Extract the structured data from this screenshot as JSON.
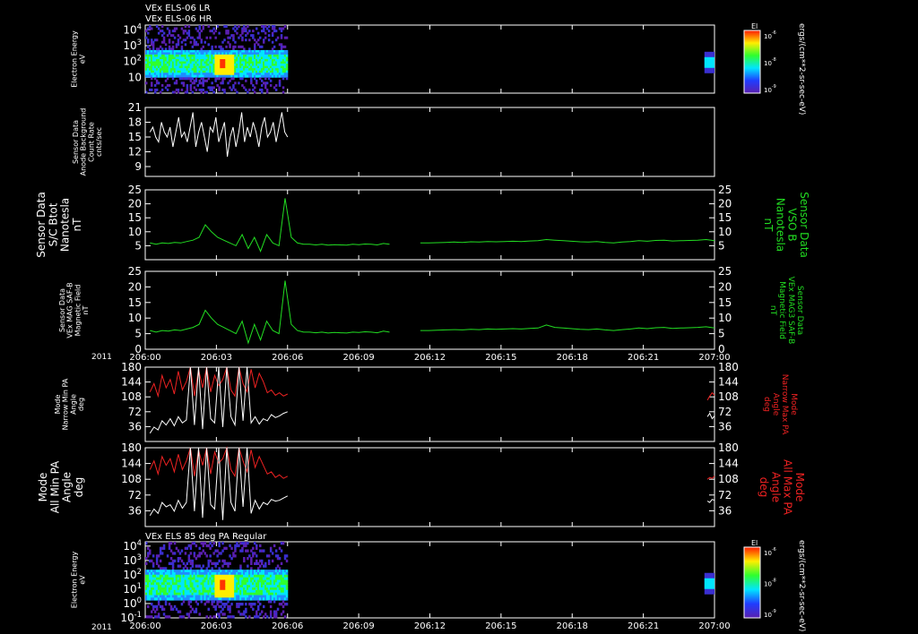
{
  "titles": {
    "top_line1": "VEx ELS-06 LR",
    "top_line2": "VEx ELS-06 HR",
    "bottom": "VEx ELS 85 deg PA Regular"
  },
  "year_label": "2011",
  "x_ticks": [
    "206:00",
    "206:03",
    "206:06",
    "206:09",
    "206:12",
    "206:15",
    "206:18",
    "206:21",
    "207:00"
  ],
  "colors": {
    "background": "#000000",
    "frame": "#ffffff",
    "green": "#22dd22",
    "red": "#ee2222",
    "white": "#ffffff"
  },
  "chart_data": [
    {
      "type": "heatmap",
      "ylabel": [
        "Electron Energy",
        "eV"
      ],
      "ytick_labels": [
        "10",
        "10^2",
        "10^3",
        "10^4"
      ],
      "y_scale": "log",
      "ylim": [
        1,
        20000
      ],
      "xlim": [
        0,
        24
      ],
      "data_interval": [
        0,
        6
      ],
      "late_interval": [
        23.5,
        24
      ],
      "colorbar": {
        "title": "El",
        "tick_labels": [
          "10^-6",
          "10^-8",
          "10^-9"
        ],
        "unit": "ergs/(cm**2-sr-sec-eV)"
      }
    },
    {
      "type": "line",
      "ylabel": [
        "Sensor Data",
        "Anode Background",
        "Count Rate",
        "cnts/sec"
      ],
      "ytick_labels": [
        "9",
        "12",
        "15",
        "18",
        "21"
      ],
      "ylim": [
        7,
        21
      ],
      "xlim": [
        0,
        24
      ],
      "series": [
        {
          "color": "#ffffff",
          "segments": [
            {
              "t0": 0.2,
              "t1": 6.0,
              "values": [
                16,
                17,
                15,
                14,
                18,
                16,
                15,
                17,
                13,
                16,
                19,
                15,
                16,
                14,
                17,
                20,
                13,
                16,
                18,
                15,
                12,
                17,
                16,
                19,
                14,
                16,
                18,
                11,
                15,
                17,
                13,
                16,
                20,
                14,
                17,
                15,
                18,
                16,
                13,
                17,
                19,
                15,
                16,
                18,
                14,
                17,
                20,
                16,
                15
              ]
            }
          ]
        }
      ]
    },
    {
      "type": "line",
      "ylabel": [
        "Sensor Data",
        "S/C Btot",
        "Nanotesla",
        "nT"
      ],
      "right_label": [
        "Sensor Data",
        "VSO B",
        "Nanotesla",
        "nT"
      ],
      "ytick_labels": [
        "5",
        "10",
        "15",
        "20",
        "25"
      ],
      "ylim": [
        0,
        25
      ],
      "xlim": [
        0,
        24
      ],
      "series": [
        {
          "color": "#22dd22",
          "segments": [
            {
              "t0": 0.2,
              "t1": 10.3,
              "values": [
                6,
                5.5,
                6,
                5.8,
                6.2,
                6,
                6.5,
                7,
                8,
                12.5,
                10,
                8,
                7,
                6,
                5,
                9,
                4,
                8,
                3,
                9,
                6,
                5,
                22,
                8,
                6,
                5.5,
                5.5,
                5.3,
                5.5,
                5.2,
                5.4,
                5.3,
                5.2,
                5.5,
                5.4,
                5.6,
                5.5,
                5.3,
                5.8,
                5.5
              ]
            },
            {
              "t0": 11.6,
              "t1": 24.0,
              "values": [
                6,
                6,
                6.1,
                6.2,
                6.3,
                6.2,
                6.4,
                6.3,
                6.5,
                6.4,
                6.5,
                6.6,
                6.5,
                6.7,
                6.8,
                7.2,
                7,
                6.8,
                6.6,
                6.4,
                6.3,
                6.5,
                6.2,
                6,
                6.3,
                6.5,
                6.8,
                6.6,
                6.9,
                7,
                6.7,
                6.8,
                6.9,
                7,
                7.2,
                6.8
              ]
            }
          ]
        }
      ]
    },
    {
      "type": "line",
      "ylabel": [
        "Sensor Data",
        "VEx MAG SAF-B",
        "Magnetic Field",
        "nT"
      ],
      "right_label": [
        "Sensor Data",
        "VEx MAG3 SAF-B",
        "Magnetic Field",
        "nT"
      ],
      "ytick_labels": [
        "0",
        "5",
        "10",
        "15",
        "20",
        "25"
      ],
      "ylim": [
        0,
        25
      ],
      "xlim": [
        0,
        24
      ],
      "series": [
        {
          "color": "#22dd22",
          "segments": [
            {
              "t0": 0.2,
              "t1": 10.3,
              "values": [
                6,
                5.5,
                6,
                5.8,
                6.2,
                6,
                6.5,
                7,
                8,
                12.5,
                10,
                8,
                7,
                6,
                5,
                9,
                2,
                8,
                3,
                9,
                6,
                5,
                22,
                8,
                6,
                5.5,
                5.5,
                5.3,
                5.5,
                5.2,
                5.4,
                5.3,
                5.2,
                5.5,
                5.4,
                5.6,
                5.5,
                5.3,
                5.8,
                5.5
              ]
            },
            {
              "t0": 11.6,
              "t1": 24.0,
              "values": [
                6,
                6,
                6.1,
                6.2,
                6.3,
                6.2,
                6.4,
                6.3,
                6.5,
                6.4,
                6.5,
                6.6,
                6.5,
                6.7,
                6.8,
                7.8,
                7,
                6.8,
                6.6,
                6.4,
                6.3,
                6.5,
                6.2,
                6,
                6.3,
                6.5,
                6.8,
                6.6,
                6.9,
                7,
                6.7,
                6.8,
                6.9,
                7,
                7.2,
                6.8
              ]
            }
          ]
        }
      ]
    },
    {
      "type": "line",
      "ylabel": [
        "Mode",
        "Narrow Min PA",
        "Angle",
        "deg"
      ],
      "right_label": [
        "Mode",
        "Narrow Max PA",
        "Angle",
        "deg"
      ],
      "ytick_labels": [
        "36",
        "72",
        "108",
        "144",
        "180"
      ],
      "ylim": [
        0,
        180
      ],
      "xlim": [
        0,
        24
      ],
      "series": [
        {
          "color": "#ee2222",
          "segments": [
            {
              "t0": 0.2,
              "t1": 6.0,
              "values": [
                120,
                140,
                110,
                160,
                130,
                150,
                115,
                170,
                125,
                145,
                180,
                110,
                175,
                130,
                180,
                120,
                160,
                135,
                150,
                180,
                125,
                110,
                180,
                140,
                120,
                175,
                130,
                165,
                145,
                118,
                125,
                112,
                118,
                110,
                115
              ]
            },
            {
              "t0": 23.7,
              "t1": 24.0,
              "values": [
                100,
                110,
                118,
                112
              ]
            }
          ]
        },
        {
          "color": "#ffffff",
          "segments": [
            {
              "t0": 0.2,
              "t1": 6.0,
              "values": [
                20,
                35,
                28,
                50,
                40,
                55,
                38,
                60,
                45,
                52,
                180,
                40,
                180,
                30,
                180,
                55,
                45,
                180,
                35,
                180,
                60,
                40,
                180,
                50,
                180,
                45,
                60,
                42,
                55,
                50,
                65,
                58,
                62,
                68,
                72
              ]
            },
            {
              "t0": 23.7,
              "t1": 24.0,
              "values": [
                60,
                68,
                55,
                62
              ]
            }
          ]
        }
      ]
    },
    {
      "type": "line",
      "ylabel": [
        "Mode",
        "All Min PA",
        "Angle",
        "deg"
      ],
      "right_label": [
        "Mode",
        "All Max PA",
        "Angle",
        "deg"
      ],
      "ytick_labels": [
        "36",
        "72",
        "108",
        "144",
        "180"
      ],
      "ylim": [
        0,
        180
      ],
      "xlim": [
        0,
        24
      ],
      "series": [
        {
          "color": "#ee2222",
          "segments": [
            {
              "t0": 0.2,
              "t1": 6.0,
              "values": [
                130,
                150,
                120,
                160,
                140,
                155,
                125,
                165,
                130,
                150,
                180,
                115,
                175,
                140,
                180,
                120,
                170,
                145,
                155,
                180,
                130,
                115,
                180,
                150,
                125,
                175,
                135,
                160,
                140,
                120,
                125,
                112,
                118,
                110,
                115
              ]
            },
            {
              "t0": 23.7,
              "t1": 24.0,
              "values": [
                108,
                112,
                110,
                115
              ]
            }
          ]
        },
        {
          "color": "#ffffff",
          "segments": [
            {
              "t0": 0.2,
              "t1": 6.0,
              "values": [
                25,
                40,
                30,
                55,
                45,
                50,
                35,
                60,
                42,
                55,
                180,
                35,
                180,
                20,
                180,
                50,
                40,
                180,
                15,
                180,
                55,
                35,
                180,
                45,
                180,
                30,
                60,
                40,
                55,
                50,
                62,
                58,
                60,
                65,
                70
              ]
            },
            {
              "t0": 23.7,
              "t1": 24.0,
              "values": [
                58,
                55,
                62,
                60
              ]
            }
          ]
        }
      ]
    },
    {
      "type": "heatmap",
      "ylabel": [
        "Electron Energy",
        "eV"
      ],
      "ytick_labels": [
        "10^-1",
        "10^0",
        "10^1",
        "10^2",
        "10^3",
        "10^4"
      ],
      "y_scale": "log",
      "ylim": [
        0.1,
        20000
      ],
      "xlim": [
        0,
        24
      ],
      "data_interval": [
        0,
        6
      ],
      "late_interval": [
        23.5,
        24
      ],
      "colorbar": {
        "title": "El",
        "tick_labels": [
          "10^-6",
          "10^-8",
          "10^-9"
        ],
        "unit": "ergs/(cm**2-sr-sec-eV)"
      }
    }
  ]
}
